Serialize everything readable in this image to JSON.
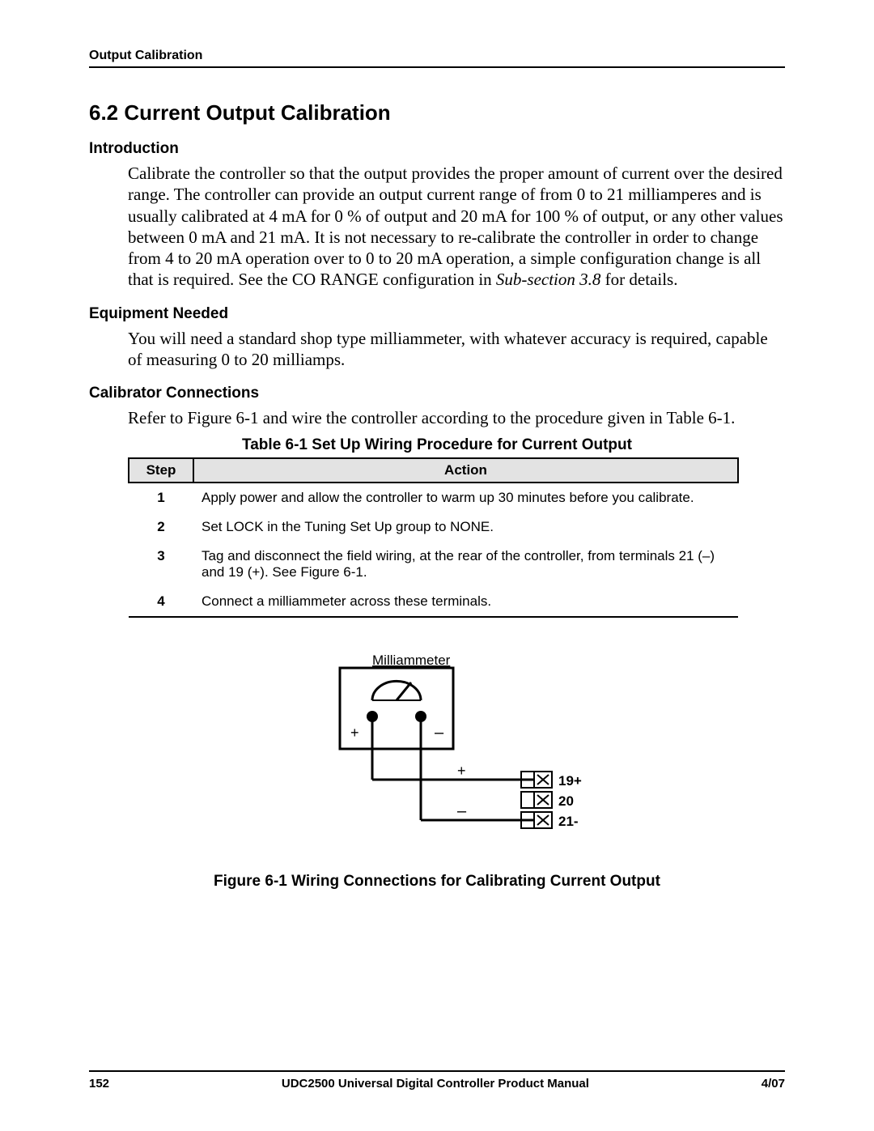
{
  "header": {
    "running": "Output Calibration"
  },
  "section": {
    "numtitle": "6.2  Current Output Calibration"
  },
  "intro": {
    "head": "Introduction",
    "body_a": "Calibrate the controller so that the output provides the proper amount of current over the desired range. The controller can provide an output current range of from 0 to 21 milliamperes and is usually calibrated at 4 mA for 0 % of output and 20 mA for 100 % of output, or any other values between 0 mA and 21 mA.  It is not necessary to re-calibrate the controller in order to change from 4 to 20 mA operation over to 0 to 20 mA operation, a simple configuration change is all that is required.  See the CO RANGE configuration in ",
    "body_ref": "Sub-section 3.8",
    "body_b": " for details."
  },
  "equip": {
    "head": "Equipment Needed",
    "body": "You will need a standard shop type milliammeter, with whatever accuracy is required, capable of measuring 0 to 20 milliamps."
  },
  "conn": {
    "head": "Calibrator Connections",
    "body": "Refer to Figure 6-1 and wire the controller according to the procedure given in Table 6-1."
  },
  "table": {
    "caption": "Table 6-1  Set Up Wiring Procedure for Current Output",
    "col_step": "Step",
    "col_action": "Action",
    "rows": [
      {
        "n": "1",
        "t": "Apply power and allow the controller to warm up 30 minutes before you calibrate."
      },
      {
        "n": "2",
        "t": "Set LOCK in the Tuning Set Up group to NONE."
      },
      {
        "n": "3",
        "t": "Tag and disconnect the field wiring, at the rear of the controller, from terminals 21 (–) and 19 (+). See Figure 6-1."
      },
      {
        "n": "4",
        "t": "Connect a milliammeter across these terminals."
      }
    ]
  },
  "figure": {
    "milli_label": "Milliammeter",
    "plus": "+",
    "minus": "–",
    "t19": "19+",
    "t20": "20",
    "t21": "21-",
    "caption": "Figure 6-1  Wiring Connections for Calibrating Current Output"
  },
  "footer": {
    "page": "152",
    "title": "UDC2500 Universal Digital Controller Product Manual",
    "date": "4/07"
  }
}
